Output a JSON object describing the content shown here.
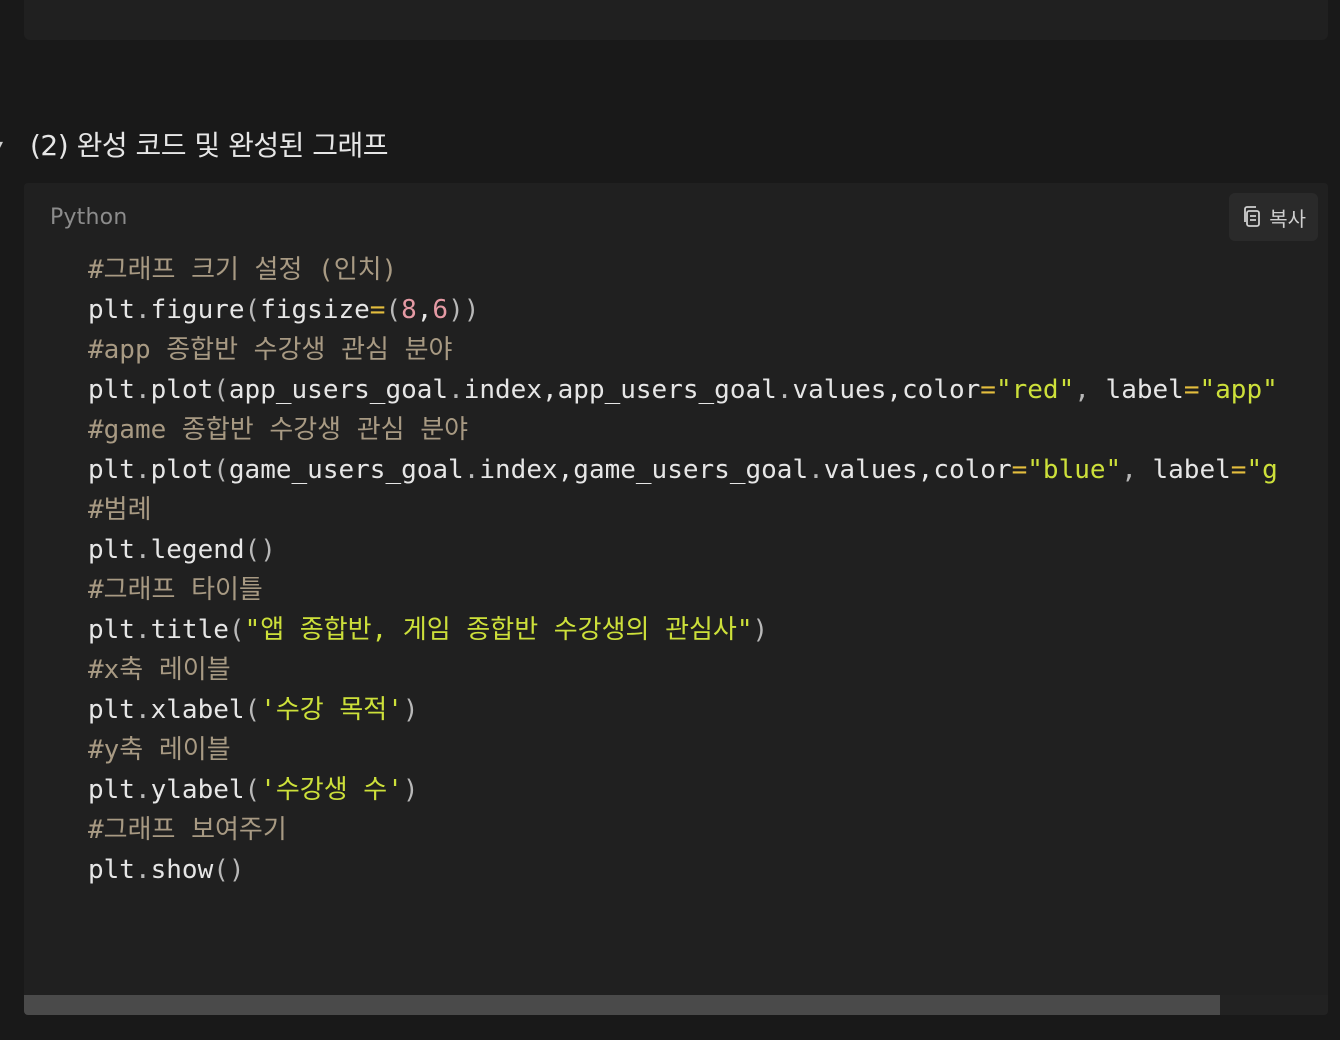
{
  "section": {
    "toggle_symbol": "▾",
    "heading": "(2) 완성 코드 및 완성된 그래프"
  },
  "code_block": {
    "language": "Python",
    "copy_label": "복사",
    "copy_icon": "copy-icon",
    "lines": [
      [
        {
          "t": "#그래프 크기 설정 (인치)",
          "c": "comment"
        }
      ],
      [
        {
          "t": "plt",
          "c": "plain"
        },
        {
          "t": ".",
          "c": "punc"
        },
        {
          "t": "figure",
          "c": "plain"
        },
        {
          "t": "(",
          "c": "punc"
        },
        {
          "t": "figsize",
          "c": "plain"
        },
        {
          "t": "=",
          "c": "op"
        },
        {
          "t": "(",
          "c": "punc"
        },
        {
          "t": "8",
          "c": "num"
        },
        {
          "t": ",",
          "c": "plain"
        },
        {
          "t": "6",
          "c": "num"
        },
        {
          "t": "))",
          "c": "punc"
        }
      ],
      [
        {
          "t": "#app 종합반 수강생 관심 분야",
          "c": "comment"
        }
      ],
      [
        {
          "t": "plt",
          "c": "plain"
        },
        {
          "t": ".",
          "c": "punc"
        },
        {
          "t": "plot",
          "c": "plain"
        },
        {
          "t": "(",
          "c": "punc"
        },
        {
          "t": "app_users_goal",
          "c": "plain"
        },
        {
          "t": ".",
          "c": "punc"
        },
        {
          "t": "index,app_users_goal",
          "c": "plain"
        },
        {
          "t": ".",
          "c": "punc"
        },
        {
          "t": "values,color",
          "c": "plain"
        },
        {
          "t": "=",
          "c": "op"
        },
        {
          "t": "\"red\"",
          "c": "str"
        },
        {
          "t": ", ",
          "c": "punc"
        },
        {
          "t": "label",
          "c": "plain"
        },
        {
          "t": "=",
          "c": "op"
        },
        {
          "t": "\"app\"",
          "c": "str"
        }
      ],
      [
        {
          "t": "#game 종합반 수강생 관심 분야",
          "c": "comment"
        }
      ],
      [
        {
          "t": "plt",
          "c": "plain"
        },
        {
          "t": ".",
          "c": "punc"
        },
        {
          "t": "plot",
          "c": "plain"
        },
        {
          "t": "(",
          "c": "punc"
        },
        {
          "t": "game_users_goal",
          "c": "plain"
        },
        {
          "t": ".",
          "c": "punc"
        },
        {
          "t": "index,game_users_goal",
          "c": "plain"
        },
        {
          "t": ".",
          "c": "punc"
        },
        {
          "t": "values,color",
          "c": "plain"
        },
        {
          "t": "=",
          "c": "op"
        },
        {
          "t": "\"blue\"",
          "c": "str"
        },
        {
          "t": ", ",
          "c": "punc"
        },
        {
          "t": "label",
          "c": "plain"
        },
        {
          "t": "=",
          "c": "op"
        },
        {
          "t": "\"g",
          "c": "str"
        }
      ],
      [
        {
          "t": "#범례",
          "c": "comment"
        }
      ],
      [
        {
          "t": "plt",
          "c": "plain"
        },
        {
          "t": ".",
          "c": "punc"
        },
        {
          "t": "legend",
          "c": "plain"
        },
        {
          "t": "()",
          "c": "punc"
        }
      ],
      [
        {
          "t": "#그래프 타이틀",
          "c": "comment"
        }
      ],
      [
        {
          "t": "plt",
          "c": "plain"
        },
        {
          "t": ".",
          "c": "punc"
        },
        {
          "t": "title",
          "c": "plain"
        },
        {
          "t": "(",
          "c": "punc"
        },
        {
          "t": "\"앱 종합반, 게임 종합반 수강생의 관심사\"",
          "c": "str"
        },
        {
          "t": ")",
          "c": "punc"
        }
      ],
      [
        {
          "t": "#x축 레이블",
          "c": "comment"
        }
      ],
      [
        {
          "t": "plt",
          "c": "plain"
        },
        {
          "t": ".",
          "c": "punc"
        },
        {
          "t": "xlabel",
          "c": "plain"
        },
        {
          "t": "(",
          "c": "punc"
        },
        {
          "t": "'수강 목적'",
          "c": "str"
        },
        {
          "t": ")",
          "c": "punc"
        }
      ],
      [
        {
          "t": "#y축 레이블",
          "c": "comment"
        }
      ],
      [
        {
          "t": "plt",
          "c": "plain"
        },
        {
          "t": ".",
          "c": "punc"
        },
        {
          "t": "ylabel",
          "c": "plain"
        },
        {
          "t": "(",
          "c": "punc"
        },
        {
          "t": "'수강생 수'",
          "c": "str"
        },
        {
          "t": ")",
          "c": "punc"
        }
      ],
      [
        {
          "t": "#그래프 보여주기",
          "c": "comment"
        }
      ],
      [
        {
          "t": "plt",
          "c": "plain"
        },
        {
          "t": ".",
          "c": "punc"
        },
        {
          "t": "show",
          "c": "plain"
        },
        {
          "t": "()",
          "c": "punc"
        }
      ]
    ]
  },
  "colors": {
    "background": "#191919",
    "panel": "#202020",
    "comment": "#a89a83",
    "string": "#cde03a",
    "number": "#e59aa4",
    "operator": "#e4be3e"
  }
}
